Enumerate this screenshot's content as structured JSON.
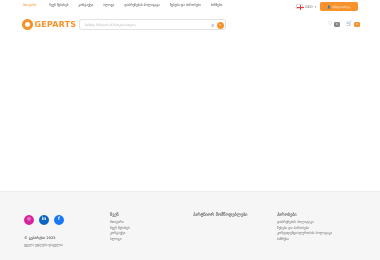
{
  "topnav": {
    "links": [
      "მთავარი",
      "ჩვენ შესახებ",
      "კონტაქტი",
      "ბლოგი",
      "დაბრუნების პოლიტიკა",
      "წესები და პირობები",
      "ბიზნესი"
    ],
    "active_index": 0
  },
  "language": {
    "code": "GEO"
  },
  "signin": {
    "label": "შესვლა/რეგ."
  },
  "logo": {
    "text": "GEPARTS"
  },
  "search": {
    "placeholder": "ჩაწერე ნაწილის ან მარკის სახელი"
  },
  "header_icons": {
    "wishlist_count": "0",
    "cart_count": "0"
  },
  "footer": {
    "social": [
      "instagram-icon",
      "linkedin-icon",
      "facebook-icon"
    ],
    "copyright": "© გეპარტსი 2025",
    "rights": "ყველა უფლება დაცულია",
    "columns": [
      {
        "head": "ჩვენ",
        "items": [
          "მთავარი",
          "ჩვენ შესახებ",
          "კონტაქტი",
          "ბლოგი"
        ]
      },
      {
        "head": "პარტნიორ მომწოდებლები",
        "items": []
      },
      {
        "head": "პირობები",
        "items": [
          "დაბრუნების პოლიტიკა",
          "წესები და პირობები",
          "კონფიდენციალურობის პოლიტიკა",
          "ბიზნესი"
        ]
      }
    ]
  },
  "colors": {
    "accent": "#f7932a"
  }
}
